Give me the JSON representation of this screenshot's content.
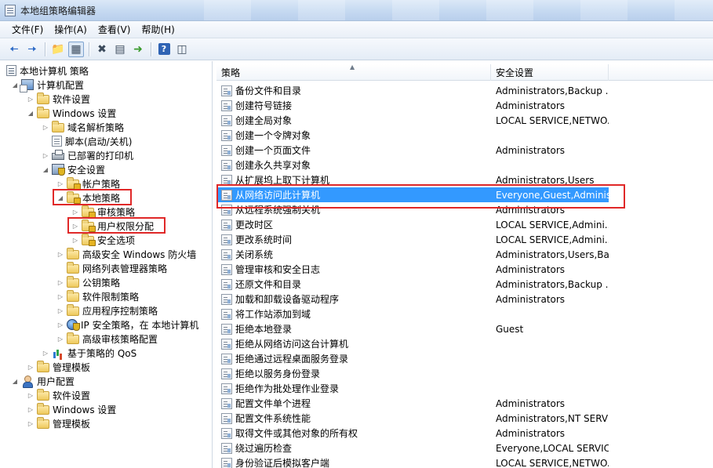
{
  "window": {
    "title": "本地组策略编辑器"
  },
  "menu": [
    "文件(F)",
    "操作(A)",
    "查看(V)",
    "帮助(H)"
  ],
  "toolbar": {
    "buttons": [
      "back-icon",
      "forward-icon",
      "up-folder-icon",
      "show-tree-icon",
      "delete-icon",
      "properties-icon",
      "export-icon",
      "help-icon",
      "show-pane-icon"
    ]
  },
  "tree": [
    {
      "label": "本地计算机 策略"
    },
    {
      "label": "计算机配置"
    },
    {
      "label": "软件设置"
    },
    {
      "label": "Windows 设置"
    },
    {
      "label": "域名解析策略"
    },
    {
      "label": "脚本(启动/关机)"
    },
    {
      "label": "已部署的打印机"
    },
    {
      "label": "安全设置"
    },
    {
      "label": "帐户策略"
    },
    {
      "label": "本地策略"
    },
    {
      "label": "审核策略"
    },
    {
      "label": "用户权限分配"
    },
    {
      "label": "安全选项"
    },
    {
      "label": "高级安全 Windows 防火墙"
    },
    {
      "label": "网络列表管理器策略"
    },
    {
      "label": "公钥策略"
    },
    {
      "label": "软件限制策略"
    },
    {
      "label": "应用程序控制策略"
    },
    {
      "label": "IP 安全策略，在 本地计算机"
    },
    {
      "label": "高级审核策略配置"
    },
    {
      "label": "基于策略的 QoS"
    },
    {
      "label": "管理模板"
    },
    {
      "label": "用户配置"
    },
    {
      "label": "软件设置"
    },
    {
      "label": "Windows 设置"
    },
    {
      "label": "管理模板"
    }
  ],
  "list": {
    "columns": [
      "策略",
      "安全设置"
    ],
    "rows": [
      {
        "policy": "备份文件和目录",
        "setting": "Administrators,Backup ..."
      },
      {
        "policy": "创建符号链接",
        "setting": "Administrators"
      },
      {
        "policy": "创建全局对象",
        "setting": "LOCAL SERVICE,NETWO..."
      },
      {
        "policy": "创建一个令牌对象",
        "setting": ""
      },
      {
        "policy": "创建一个页面文件",
        "setting": "Administrators"
      },
      {
        "policy": "创建永久共享对象",
        "setting": ""
      },
      {
        "policy": "从扩展坞上取下计算机",
        "setting": "Administrators,Users"
      },
      {
        "policy": "从网络访问此计算机",
        "setting": "Everyone,Guest,Adminis..."
      },
      {
        "policy": "从远程系统强制关机",
        "setting": "Administrators"
      },
      {
        "policy": "更改时区",
        "setting": "LOCAL SERVICE,Admini..."
      },
      {
        "policy": "更改系统时间",
        "setting": "LOCAL SERVICE,Admini..."
      },
      {
        "policy": "关闭系统",
        "setting": "Administrators,Users,Ba..."
      },
      {
        "policy": "管理审核和安全日志",
        "setting": "Administrators"
      },
      {
        "policy": "还原文件和目录",
        "setting": "Administrators,Backup ..."
      },
      {
        "policy": "加载和卸载设备驱动程序",
        "setting": "Administrators"
      },
      {
        "policy": "将工作站添加到域",
        "setting": ""
      },
      {
        "policy": "拒绝本地登录",
        "setting": "Guest"
      },
      {
        "policy": "拒绝从网络访问这台计算机",
        "setting": ""
      },
      {
        "policy": "拒绝通过远程桌面服务登录",
        "setting": ""
      },
      {
        "policy": "拒绝以服务身份登录",
        "setting": ""
      },
      {
        "policy": "拒绝作为批处理作业登录",
        "setting": ""
      },
      {
        "policy": "配置文件单个进程",
        "setting": "Administrators"
      },
      {
        "policy": "配置文件系统性能",
        "setting": "Administrators,NT SERVI..."
      },
      {
        "policy": "取得文件或其他对象的所有权",
        "setting": "Administrators"
      },
      {
        "policy": "绕过遍历检查",
        "setting": "Everyone,LOCAL SERVIC..."
      },
      {
        "policy": "身份验证后模拟客户端",
        "setting": "LOCAL SERVICE,NETWO..."
      }
    ]
  },
  "colors": {
    "selection": "#3399ff",
    "highlight_box": "#e02828"
  }
}
